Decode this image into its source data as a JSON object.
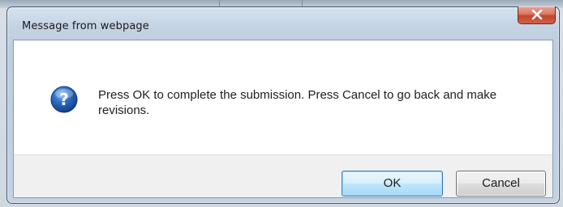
{
  "dialog": {
    "title": "Message from webpage",
    "message": "Press OK to complete the submission. Press Cancel to go back and make revisions.",
    "icon": "question-icon",
    "ok_label": "OK",
    "cancel_label": "Cancel",
    "close_icon": "close-icon"
  },
  "colors": {
    "close_button": "#c4452a",
    "ok_button_border": "#3c7fb1",
    "question_icon": "#1f5fa8"
  }
}
